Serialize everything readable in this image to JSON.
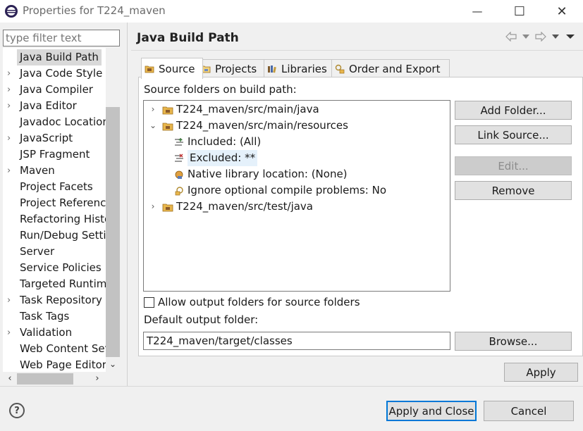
{
  "window": {
    "title": "Properties for T224_maven",
    "minimize_glyph": "—",
    "maximize_glyph": "☐",
    "close_glyph": "✕"
  },
  "filter": {
    "placeholder": "type filter text",
    "value": ""
  },
  "nav": {
    "items": [
      {
        "label": "Java Build Path",
        "expandable": false,
        "selected": true
      },
      {
        "label": "Java Code Style",
        "expandable": true
      },
      {
        "label": "Java Compiler",
        "expandable": true
      },
      {
        "label": "Java Editor",
        "expandable": true
      },
      {
        "label": "Javadoc Location",
        "expandable": false
      },
      {
        "label": "JavaScript",
        "expandable": true
      },
      {
        "label": "JSP Fragment",
        "expandable": false
      },
      {
        "label": "Maven",
        "expandable": true
      },
      {
        "label": "Project Facets",
        "expandable": false
      },
      {
        "label": "Project References",
        "expandable": false
      },
      {
        "label": "Refactoring History",
        "expandable": false
      },
      {
        "label": "Run/Debug Settings",
        "expandable": false
      },
      {
        "label": "Server",
        "expandable": false
      },
      {
        "label": "Service Policies",
        "expandable": false
      },
      {
        "label": "Targeted Runtimes",
        "expandable": false
      },
      {
        "label": "Task Repository",
        "expandable": true
      },
      {
        "label": "Task Tags",
        "expandable": false
      },
      {
        "label": "Validation",
        "expandable": true
      },
      {
        "label": "Web Content Settings",
        "expandable": false
      },
      {
        "label": "Web Page Editor",
        "expandable": false
      }
    ]
  },
  "page": {
    "title": "Java Build Path"
  },
  "tabs": [
    {
      "label": "Source",
      "icon": "source-folder-icon",
      "active": true
    },
    {
      "label": "Projects",
      "icon": "projects-icon",
      "active": false
    },
    {
      "label": "Libraries",
      "icon": "libraries-icon",
      "active": false
    },
    {
      "label": "Order and Export",
      "icon": "order-export-icon",
      "active": false
    }
  ],
  "source": {
    "label": "Source folders on build path:",
    "tree": [
      {
        "label": "T224_maven/src/main/java",
        "level": 0,
        "twisty": "collapsed",
        "icon": "package-folder-icon"
      },
      {
        "label": "T224_maven/src/main/resources",
        "level": 0,
        "twisty": "expanded",
        "icon": "package-folder-icon"
      },
      {
        "label": "Included: (All)",
        "level": 1,
        "twisty": "none",
        "icon": "inclusion-filter-icon"
      },
      {
        "label": "Excluded: **",
        "level": 1,
        "twisty": "none",
        "icon": "exclusion-filter-icon",
        "highlighted": true
      },
      {
        "label": "Native library location: (None)",
        "level": 1,
        "twisty": "none",
        "icon": "native-library-icon"
      },
      {
        "label": "Ignore optional compile problems: No",
        "level": 1,
        "twisty": "none",
        "icon": "ignore-problems-icon"
      },
      {
        "label": "T224_maven/src/test/java",
        "level": 0,
        "twisty": "collapsed",
        "icon": "package-folder-icon"
      }
    ],
    "buttons": {
      "add_folder": "Add Folder...",
      "link_source": "Link Source...",
      "edit": "Edit...",
      "remove": "Remove"
    },
    "allow_output_label": "Allow output folders for source folders",
    "allow_output_checked": false,
    "default_output_label": "Default output folder:",
    "default_output_value": "T224_maven/target/classes",
    "browse": "Browse..."
  },
  "buttons": {
    "apply": "Apply",
    "apply_and_close": "Apply and Close",
    "cancel": "Cancel"
  },
  "help_glyph": "?"
}
